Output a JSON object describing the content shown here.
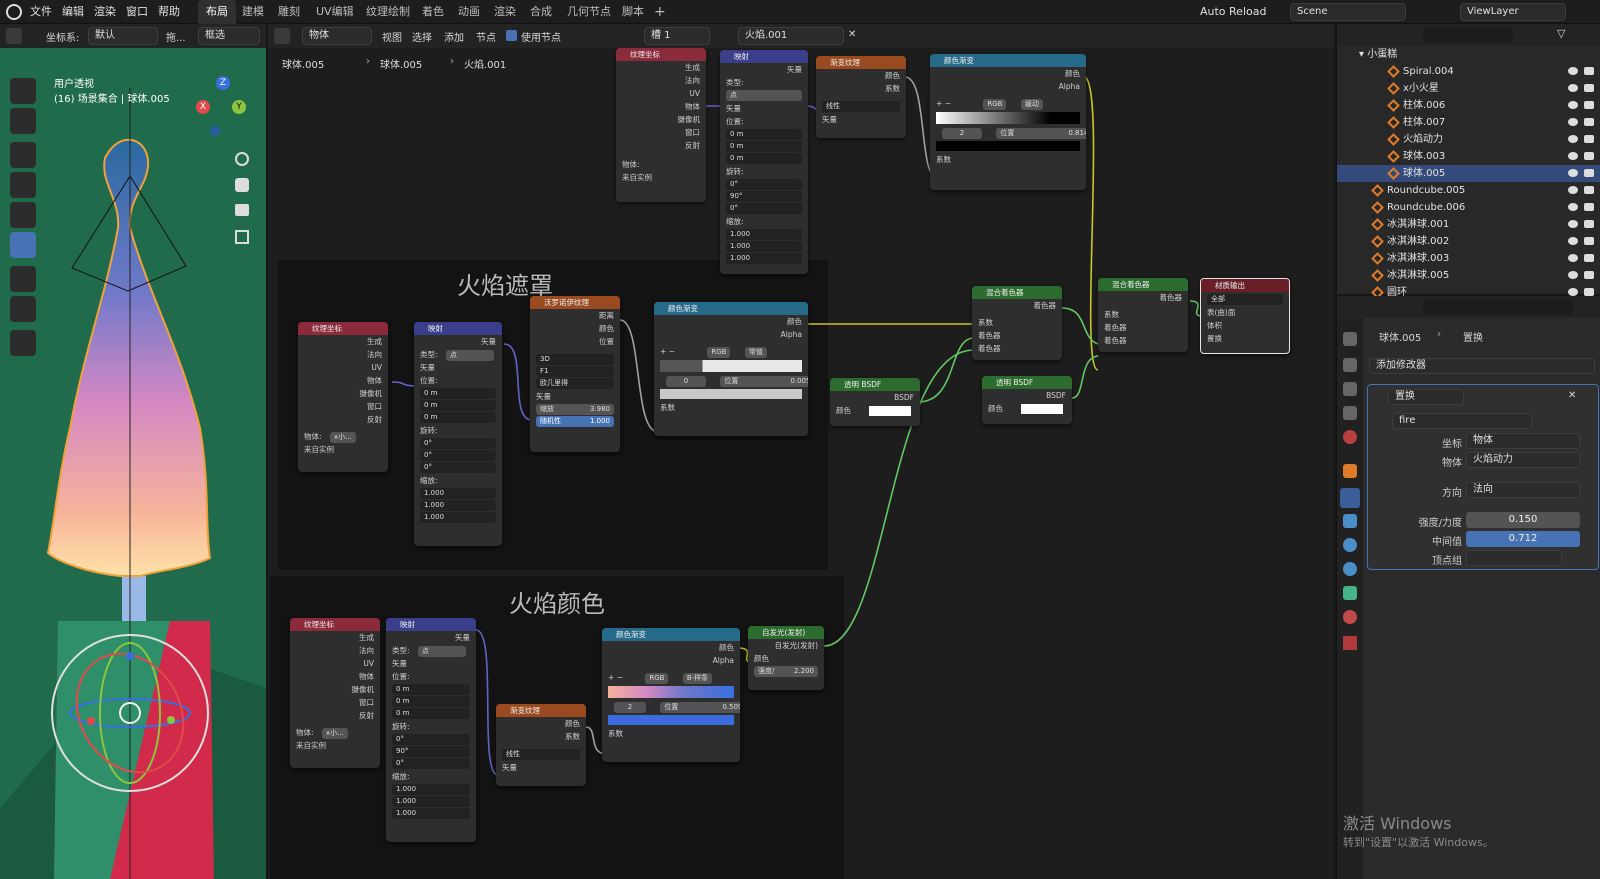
{
  "app_menu": [
    "文件",
    "编辑",
    "渲染",
    "窗口",
    "帮助"
  ],
  "workspaces": [
    "布局",
    "建模",
    "雕刻",
    "UV编辑",
    "纹理绘制",
    "着色",
    "动画",
    "渲染",
    "合成",
    "几何节点",
    "脚本"
  ],
  "active_workspace": "布局",
  "top_right": {
    "auto_reload": "Auto Reload",
    "scene": "Scene",
    "view_layer": "ViewLayer"
  },
  "viewport": {
    "coord_label": "坐标系:",
    "coord_value": "默认",
    "drag_label": "拖...",
    "select_mode": "框选",
    "view_title": "用户透视",
    "view_sub": "(16) 场景集合 | 球体.005",
    "axes": {
      "x": "X",
      "y": "Y",
      "z": "Z"
    }
  },
  "node_header": {
    "mode": "物体",
    "menus": [
      "视图",
      "选择",
      "添加",
      "节点"
    ],
    "use_nodes": "使用节点",
    "slot": "槽 1",
    "material": "火焰.001",
    "breadcrumb": [
      "球体.005",
      "球体.005",
      "火焰.001"
    ]
  },
  "frames": {
    "mask": "火焰遮罩",
    "color": "火焰颜色"
  },
  "nodes": {
    "texcoord": {
      "title": "纹理坐标",
      "outs": [
        "生成",
        "法向",
        "UV",
        "物体",
        "摄像机",
        "窗口",
        "反射"
      ],
      "object_label": "物体:",
      "from_instancer": "来自实例"
    },
    "texcoord_obj_small": "x小...",
    "mapping": {
      "title": "映射",
      "out": "矢量",
      "type_label": "类型:",
      "type_value": "点",
      "vector": "矢量",
      "location": "位置:",
      "rotation": "旋转:",
      "scale": "缩放:"
    },
    "mapping_top": {
      "loc": [
        "0 m",
        "0 m",
        "0 m"
      ],
      "rot": [
        "0°",
        "90°",
        "0°"
      ],
      "scale": [
        "1.000",
        "1.000",
        "1.000"
      ]
    },
    "mapping_mid": {
      "loc": [
        "0 m",
        "0 m",
        "0 m"
      ],
      "rot": [
        "0°",
        "0°",
        "0°"
      ],
      "scale": [
        "1.000",
        "1.000",
        "1.000"
      ]
    },
    "mapping_bot": {
      "loc": [
        "0 m",
        "0 m",
        "0 m"
      ],
      "rot": [
        "0°",
        "90°",
        "0°"
      ],
      "scale": [
        "1.000",
        "1.000",
        "1.000"
      ]
    },
    "xyz": [
      "X",
      "Y",
      "Z"
    ],
    "gradient": {
      "title": "渐变纹理",
      "outs": [
        "颜色",
        "系数"
      ],
      "mode": "线性",
      "in": "矢量"
    },
    "ramp_top": {
      "title": "颜色渐变",
      "outs": [
        "颜色",
        "Alpha"
      ],
      "mode": "RGB",
      "interp": "缓动",
      "stop": "2",
      "pos_label": "位置",
      "pos": "0.814",
      "in": "系数"
    },
    "voronoi": {
      "title": "沃罗诺伊纹理",
      "outs": [
        "距离",
        "颜色",
        "位置"
      ],
      "dim": "3D",
      "feature": "F1",
      "metric": "欧几里得",
      "in": "矢量",
      "scale_label": "缩放",
      "scale": "3.980",
      "rand_label": "随机性",
      "rand": "1.000"
    },
    "ramp_mid": {
      "title": "颜色渐变",
      "outs": [
        "颜色",
        "Alpha"
      ],
      "mode": "RGB",
      "interp": "常值",
      "stop": "0",
      "pos_label": "位置",
      "pos": "0.005",
      "in": "系数"
    },
    "ramp_bot": {
      "title": "颜色渐变",
      "outs": [
        "颜色",
        "Alpha"
      ],
      "mode": "RGB",
      "interp": "B-样条",
      "stop": "2",
      "pos_label": "位置",
      "pos": "0.509",
      "in": "系数"
    },
    "transparent1": {
      "title": "透明 BSDF",
      "out": "BSDF",
      "in": "颜色"
    },
    "transparent2": {
      "title": "透明 BSDF",
      "out": "BSDF",
      "in": "颜色"
    },
    "emission": {
      "title": "自发光(发射)",
      "out": "自发光(发射)",
      "in_color": "颜色",
      "strength_label": "强度/",
      "strength": "2.200"
    },
    "mix1": {
      "title": "混合着色器",
      "out": "着色器",
      "ins": [
        "系数",
        "着色器",
        "着色器"
      ]
    },
    "mix2": {
      "title": "混合着色器",
      "out": "着色器",
      "ins": [
        "系数",
        "着色器",
        "着色器"
      ]
    },
    "output": {
      "title": "材质输出",
      "target": "全部",
      "ins": [
        "表(曲)面",
        "体积",
        "置换"
      ]
    }
  },
  "outliner": {
    "root": "小蛋糕",
    "items": [
      {
        "name": "Spiral.004",
        "indent": 2
      },
      {
        "name": "x小火星",
        "indent": 2
      },
      {
        "name": "柱体.006",
        "indent": 2
      },
      {
        "name": "柱体.007",
        "indent": 2
      },
      {
        "name": "火焰动力",
        "indent": 2
      },
      {
        "name": "球体.003",
        "indent": 2
      },
      {
        "name": "球体.005",
        "indent": 2,
        "selected": true
      },
      {
        "name": "Roundcube.005",
        "indent": 1
      },
      {
        "name": "Roundcube.006",
        "indent": 1
      },
      {
        "name": "冰淇淋球.001",
        "indent": 1
      },
      {
        "name": "冰淇淋球.002",
        "indent": 1
      },
      {
        "name": "冰淇淋球.003",
        "indent": 1
      },
      {
        "name": "冰淇淋球.005",
        "indent": 1
      },
      {
        "name": "圆环",
        "indent": 1
      }
    ]
  },
  "properties": {
    "object": "球体.005",
    "modifier_crumb": "置换",
    "add_modifier": "添加修改器",
    "modifier_name": "置换",
    "texture": "fire",
    "coords_label": "坐标",
    "coords_value": "物体",
    "object_label": "物体",
    "object_value": "火焰动力",
    "direction_label": "方向",
    "direction_value": "法向",
    "strength_label": "强度/力度",
    "strength_value": "0.150",
    "midlevel_label": "中间值",
    "midlevel_value": "0.712",
    "vgroup_label": "顶点组"
  },
  "watermark": {
    "line1": "激活 Windows",
    "line2": "转到\"设置\"以激活 Windows。"
  }
}
